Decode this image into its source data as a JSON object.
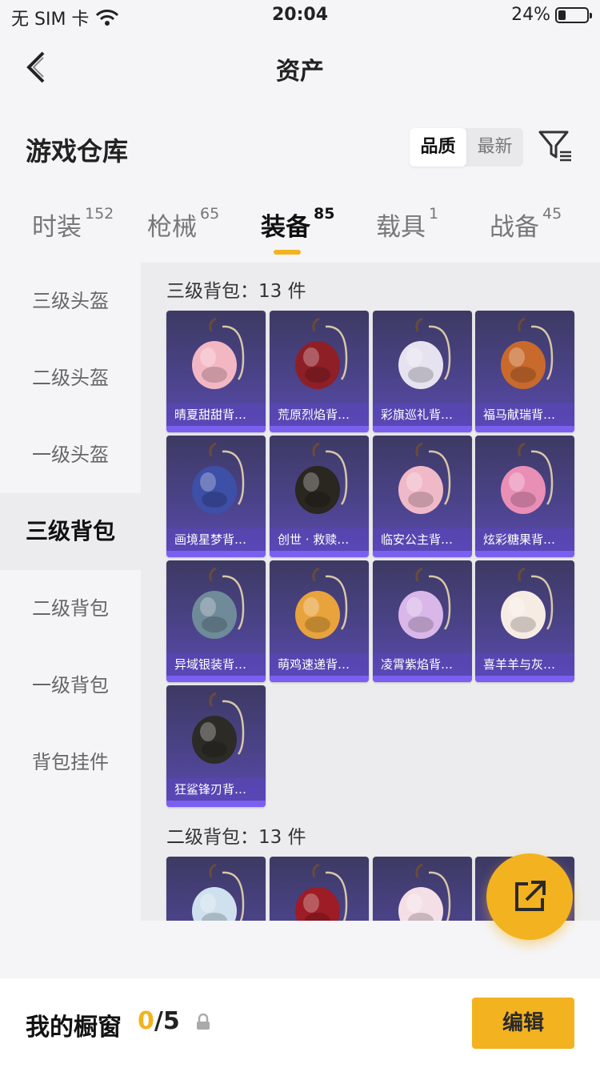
{
  "status": {
    "carrier": "无 SIM 卡",
    "time": "20:04",
    "battery": "24%",
    "battery_level": 0.24
  },
  "nav": {
    "title": "资产"
  },
  "header": {
    "title": "游戏仓库",
    "sort_options": [
      "品质",
      "最新"
    ],
    "active_sort": "品质"
  },
  "tabs": [
    {
      "label": "时装",
      "count": "152"
    },
    {
      "label": "枪械",
      "count": "65"
    },
    {
      "label": "装备",
      "count": "85"
    },
    {
      "label": "载具",
      "count": "1"
    },
    {
      "label": "战备",
      "count": "45"
    }
  ],
  "active_tab": "装备",
  "sidebar": {
    "items": [
      "三级头盔",
      "二级头盔",
      "一级头盔",
      "三级背包",
      "二级背包",
      "一级背包",
      "背包挂件"
    ],
    "active": "三级背包"
  },
  "groups": [
    {
      "title": "三级背包：13 件",
      "items": [
        {
          "name": "晴夏甜甜背…",
          "color": "#f3b7c4"
        },
        {
          "name": "荒原烈焰背…",
          "color": "#8e1f27"
        },
        {
          "name": "彩旗巡礼背…",
          "color": "#e7e2ef"
        },
        {
          "name": "福马献瑞背…",
          "color": "#c86a2c"
        },
        {
          "name": "画境星梦背…",
          "color": "#3e4fa8"
        },
        {
          "name": "创世 · 救赎…",
          "color": "#2a2620"
        },
        {
          "name": "临安公主背…",
          "color": "#f0b9c8"
        },
        {
          "name": "炫彩糖果背…",
          "color": "#e98fb6"
        },
        {
          "name": "异域银装背…",
          "color": "#6f8a99"
        },
        {
          "name": "萌鸡速递背…",
          "color": "#e8a33c"
        },
        {
          "name": "凌霄紫焰背…",
          "color": "#d9b7e8"
        },
        {
          "name": "喜羊羊与灰…",
          "color": "#f7ece4"
        },
        {
          "name": "狂鲨锋刃背…",
          "color": "#2d2b26"
        }
      ]
    },
    {
      "title": "二级背包：13 件",
      "items": [
        {
          "name": "",
          "color": "#cfe1ee"
        },
        {
          "name": "",
          "color": "#9d1c25"
        },
        {
          "name": "",
          "color": "#f4dfe6"
        },
        {
          "name": "",
          "color": "#d3c08f"
        }
      ]
    }
  ],
  "showcase": {
    "title": "我的橱窗",
    "current": "0",
    "total": "/5",
    "edit_label": "编辑"
  },
  "colors": {
    "accent": "#f3b21f",
    "card_top": "#3d3a63",
    "card_bottom": "#5b4bb1"
  }
}
